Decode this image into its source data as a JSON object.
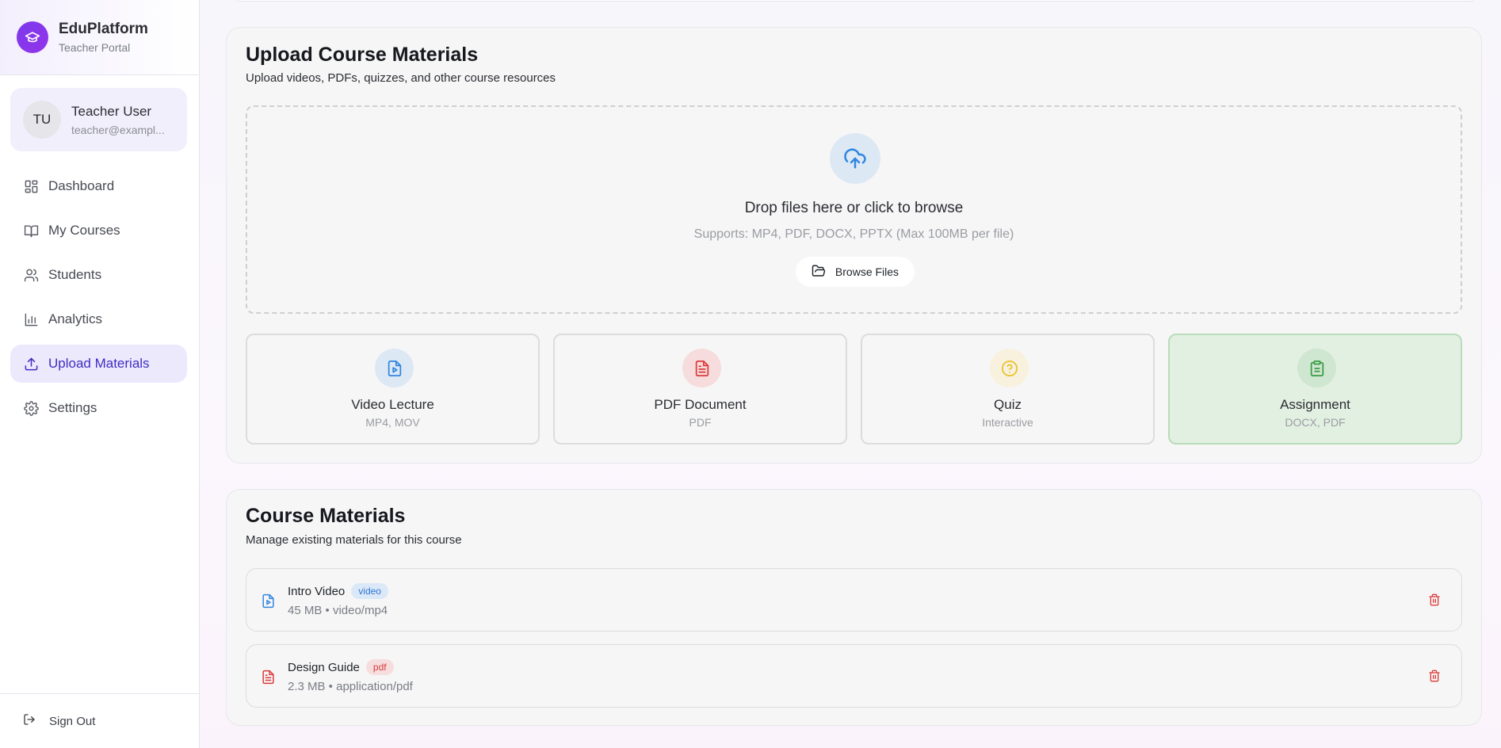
{
  "brand": {
    "name": "EduPlatform",
    "subtitle": "Teacher Portal"
  },
  "user": {
    "initials": "TU",
    "name": "Teacher User",
    "email": "teacher@exampl..."
  },
  "nav": [
    {
      "label": "Dashboard",
      "icon": "grid-icon",
      "active": false
    },
    {
      "label": "My Courses",
      "icon": "book-icon",
      "active": false
    },
    {
      "label": "Students",
      "icon": "users-icon",
      "active": false
    },
    {
      "label": "Analytics",
      "icon": "bar-chart-icon",
      "active": false
    },
    {
      "label": "Upload Materials",
      "icon": "upload-icon",
      "active": true
    },
    {
      "label": "Settings",
      "icon": "gear-icon",
      "active": false
    }
  ],
  "footer": {
    "signout_label": "Sign Out"
  },
  "upload": {
    "title": "Upload Course Materials",
    "subtitle": "Upload videos, PDFs, quizzes, and other course resources",
    "drop_title": "Drop files here or click to browse",
    "drop_sub": "Supports: MP4, PDF, DOCX, PPTX (Max 100MB per file)",
    "browse_label": "Browse Files",
    "types": [
      {
        "title": "Video Lecture",
        "sub": "MP4, MOV",
        "icon": "video-file-icon",
        "color": "#2f86e0",
        "bg": "#dde8f5",
        "selected": false
      },
      {
        "title": "PDF Document",
        "sub": "PDF",
        "icon": "pdf-file-icon",
        "color": "#dc3b3b",
        "bg": "#f6dcdc",
        "selected": false
      },
      {
        "title": "Quiz",
        "sub": "Interactive",
        "icon": "help-circle-icon",
        "color": "#e9c22b",
        "bg": "#f7f1de",
        "selected": false
      },
      {
        "title": "Assignment",
        "sub": "DOCX, PDF",
        "icon": "clipboard-icon",
        "color": "#3a9b45",
        "bg": "#cfe6d0",
        "selected": true
      }
    ]
  },
  "materials": {
    "title": "Course Materials",
    "subtitle": "Manage existing materials for this course",
    "items": [
      {
        "name": "Intro Video",
        "badge": "video",
        "meta": "45 MB • video/mp4"
      },
      {
        "name": "Design Guide",
        "badge": "pdf",
        "meta": "2.3 MB • application/pdf"
      }
    ]
  },
  "colors": {
    "accent": "#3f2dc2",
    "danger": "#dc3b3b"
  }
}
